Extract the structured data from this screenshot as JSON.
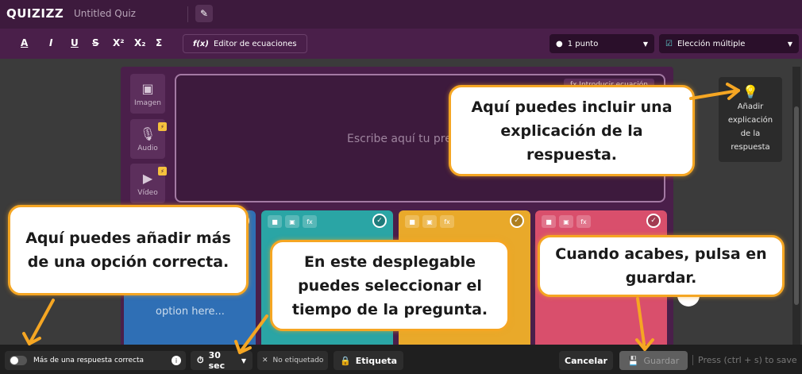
{
  "app": {
    "logo": "QUIZIZZ",
    "quiz_title": "Untitled Quiz"
  },
  "toolbar": {
    "format_buttons": [
      "A",
      "I",
      "U",
      "S",
      "X²",
      "X₂",
      "Σ"
    ],
    "equation_editor": "Editor de ecuaciones",
    "points_select": "1 punto",
    "type_select": "Elección múltiple"
  },
  "editor": {
    "media": [
      {
        "label": "Imagen",
        "icon": "image-icon"
      },
      {
        "label": "Audio",
        "icon": "microphone-icon"
      },
      {
        "label": "Vídeo",
        "icon": "video-icon"
      }
    ],
    "insert_equation": "fx Introducir ecuación",
    "question_placeholder": "Escribe aquí tu pregunta",
    "option_placeholder": "option here...",
    "option_colors": [
      "#2f6fb5",
      "#2aa5a5",
      "#e9a92a",
      "#d94f6c"
    ]
  },
  "right_panel": {
    "explanation_button": "Añadir explicación de la respuesta"
  },
  "bottom": {
    "multiple_correct": "Más de una respuesta correcta",
    "time": "30 sec",
    "tag_chip": "No etiquetado",
    "tag_button": "Etiqueta",
    "cancel": "Cancelar",
    "save": "Guardar",
    "save_hint": "Press (ctrl + s) to save"
  },
  "callouts": {
    "explanation": "Aquí puedes incluir una explicación de la respuesta.",
    "multiple": "Aquí puedes añadir más de una opción correcta.",
    "time": "En este desplegable puedes seleccionar el tiempo de la pregunta.",
    "save": "Cuando acabes, pulsa en guardar."
  }
}
